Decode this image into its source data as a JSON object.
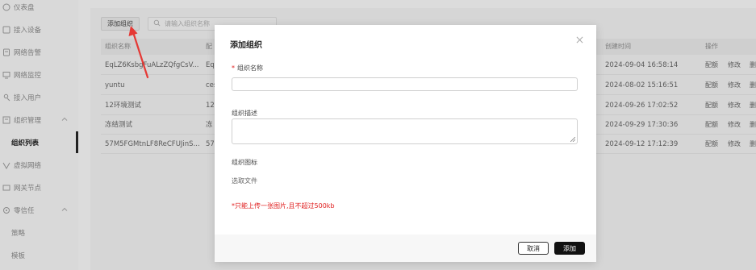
{
  "sidebar": {
    "items": [
      {
        "label": "仪表盘",
        "icon": "dashboard-icon"
      },
      {
        "label": "接入设备",
        "icon": "device-icon"
      },
      {
        "label": "网络告警",
        "icon": "alert-icon"
      },
      {
        "label": "网络监控",
        "icon": "monitor-icon"
      },
      {
        "label": "接入用户",
        "icon": "user-icon"
      },
      {
        "label": "组织管理",
        "icon": "org-icon"
      },
      {
        "label": "组织列表"
      },
      {
        "label": "虚拟网络",
        "icon": "virtual-network-icon"
      },
      {
        "label": "网关节点",
        "icon": "gateway-icon"
      },
      {
        "label": "零信任",
        "icon": "zero-trust-icon"
      },
      {
        "label": "策略"
      },
      {
        "label": "模板"
      }
    ]
  },
  "toolbar": {
    "add_label": "添加组织",
    "search_placeholder": "请输入组织名称"
  },
  "table": {
    "headers": [
      "组织名称",
      "配",
      "创建时间",
      "操作"
    ],
    "rows": [
      {
        "name": "EqLZ6KsbgFuALzZQfgCsV...",
        "cfg": "Eq",
        "created": "2024-09-04 16:58:14"
      },
      {
        "name": "yuntu",
        "cfg": "ces",
        "created": "2024-08-02 15:16:51"
      },
      {
        "name": "12环境测试",
        "cfg": "12",
        "created": "2024-09-26 17:02:52"
      },
      {
        "name": "冻结测试",
        "cfg": "冻",
        "created": "2024-09-29 17:30:36"
      },
      {
        "name": "57M5FGMtnLF8ReCFUJinS...",
        "cfg": "57",
        "created": "2024-09-12 17:12:39"
      }
    ],
    "ops": [
      "配额",
      "修改",
      "删"
    ]
  },
  "modal": {
    "title": "添加组织",
    "name_label": "组织名称",
    "desc_label": "组织描述",
    "icon_label": "组织图标",
    "pick_file": "选取文件",
    "hint": "*只能上传一张图片,且不超过500kb",
    "cancel": "取消",
    "ok": "添加"
  },
  "colors": {
    "required": "#e02020",
    "primary_button": "#111111",
    "annotation_arrow": "#e53935"
  }
}
